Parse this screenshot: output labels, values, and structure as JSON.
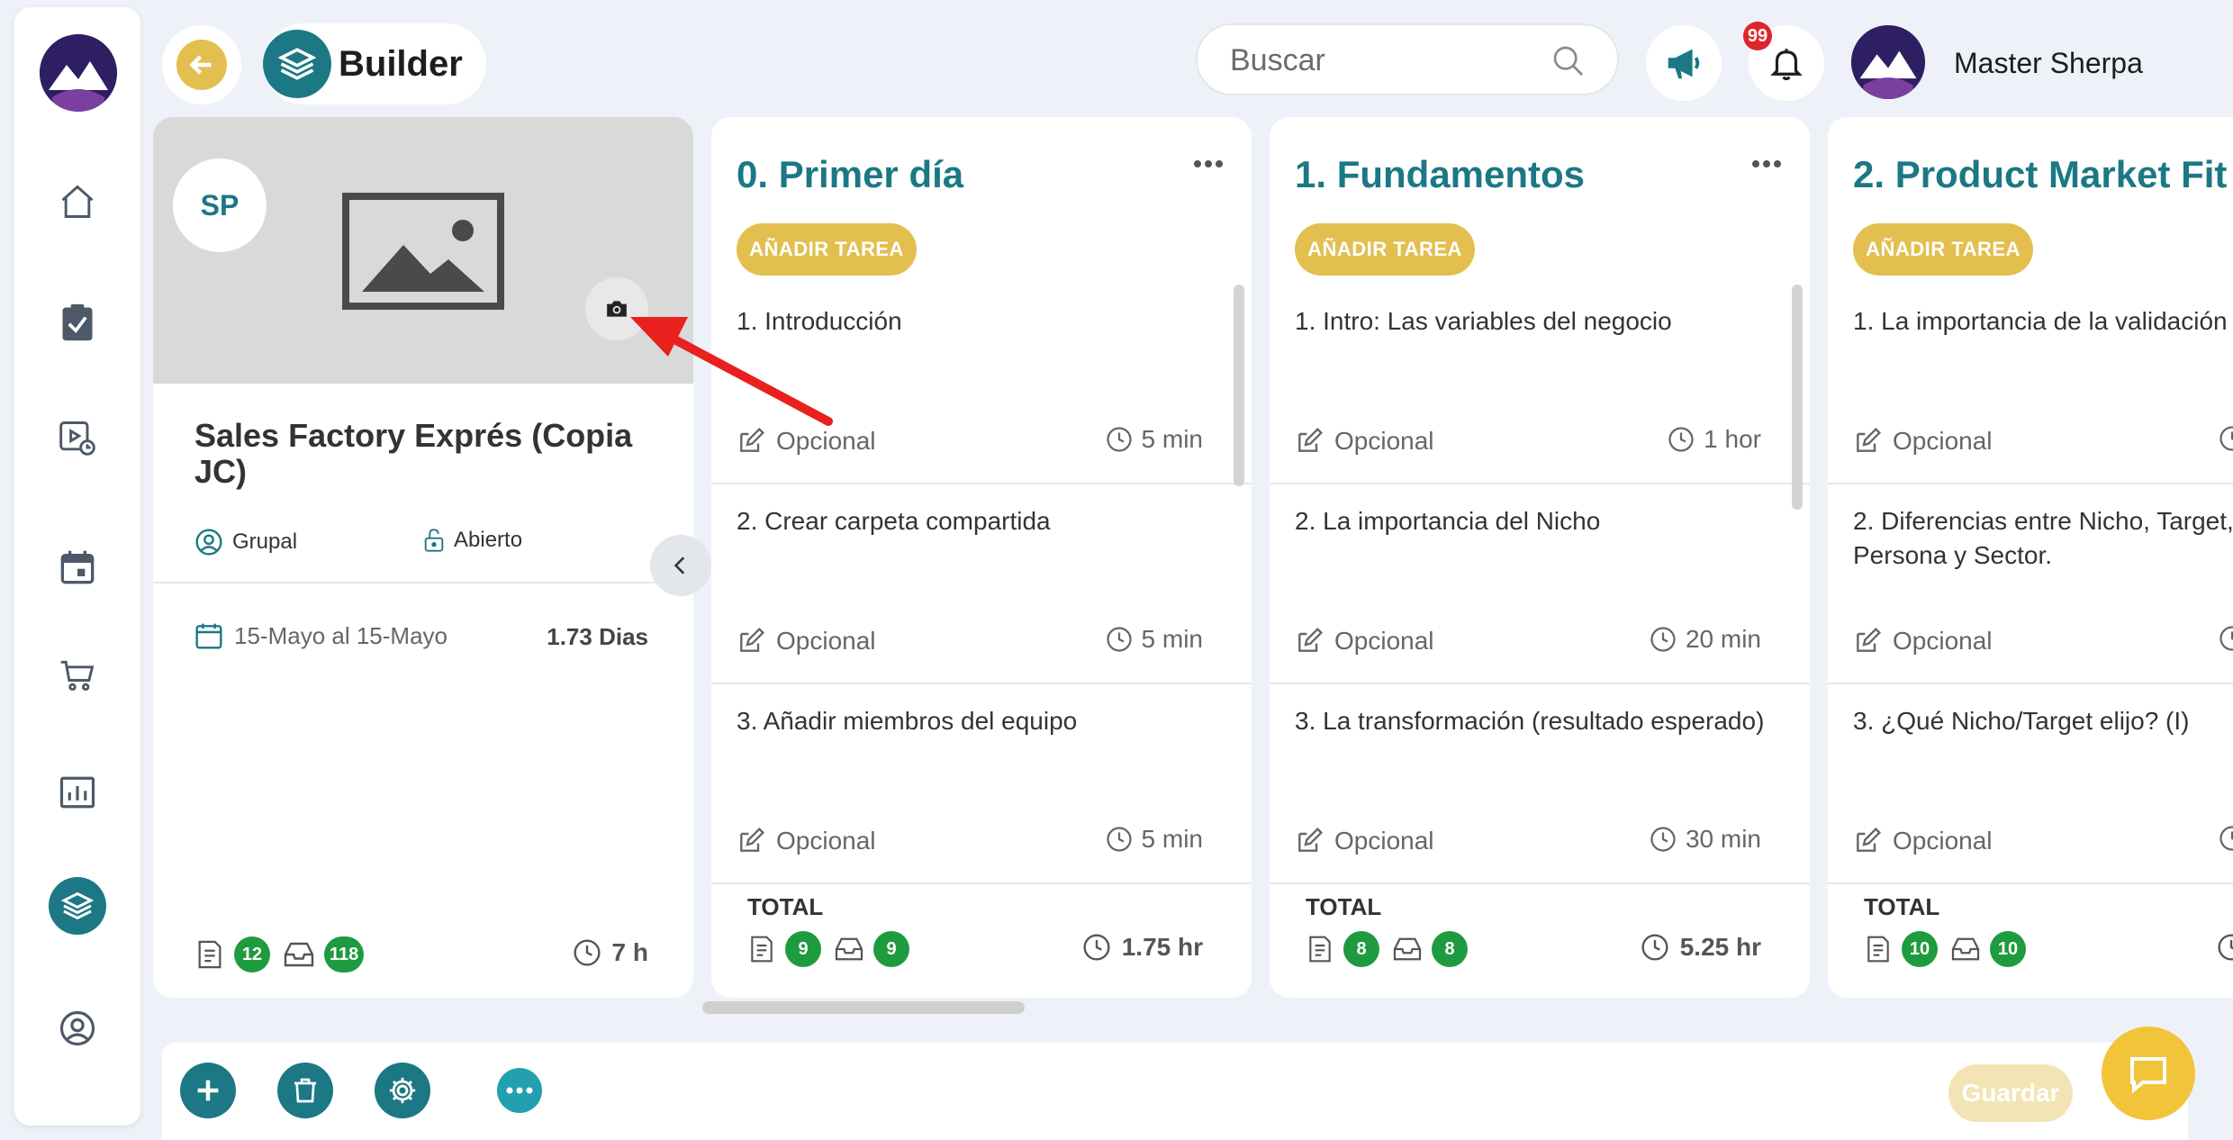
{
  "header": {
    "title": "Builder",
    "search_placeholder": "Buscar",
    "notification_count": "99",
    "user_name": "Master Sherpa"
  },
  "sidebar": {
    "items": [
      {
        "name": "home-icon"
      },
      {
        "name": "tasks-icon"
      },
      {
        "name": "video-icon"
      },
      {
        "name": "calendar-icon"
      },
      {
        "name": "cart-icon"
      },
      {
        "name": "chart-icon"
      },
      {
        "name": "layers-icon",
        "active": true
      },
      {
        "name": "user-icon"
      }
    ]
  },
  "project": {
    "initials": "SP",
    "title": "Sales Factory Exprés (Copia JC)",
    "type_label": "Grupal",
    "access_label": "Abierto",
    "date_range": "15-Mayo al 15-Mayo",
    "duration": "1.73 Dias",
    "count_tasks": "12",
    "count_items": "118",
    "total_hours": "7 h"
  },
  "columns": [
    {
      "title": "0. Primer día",
      "add_label": "AÑADIR TAREA",
      "tasks": [
        {
          "title": "1. Introducción",
          "optional": "Opcional",
          "time": "5 min"
        },
        {
          "title": "2. Crear carpeta compartida",
          "optional": "Opcional",
          "time": "5 min"
        },
        {
          "title": "3. Añadir miembros del equipo",
          "optional": "Opcional",
          "time": "5 min"
        }
      ],
      "total_label": "TOTAL",
      "count_a": "9",
      "count_b": "9",
      "hours": "1.75 hr"
    },
    {
      "title": "1. Fundamentos",
      "add_label": "AÑADIR TAREA",
      "tasks": [
        {
          "title": "1. Intro: Las variables del negocio",
          "optional": "Opcional",
          "time": "1 hor"
        },
        {
          "title": "2. La importancia del Nicho",
          "optional": "Opcional",
          "time": "20 min"
        },
        {
          "title": "3. La transformación (resultado esperado)",
          "optional": "Opcional",
          "time": "30 min"
        }
      ],
      "total_label": "TOTAL",
      "count_a": "8",
      "count_b": "8",
      "hours": "5.25 hr"
    },
    {
      "title": "2. Product Market Fit",
      "add_label": "AÑADIR TAREA",
      "tasks": [
        {
          "title": "1. La importancia de la validación",
          "optional": "Opcional",
          "time": ""
        },
        {
          "title": "2. Diferencias entre Nicho, Target, Persona y Sector.",
          "optional": "Opcional",
          "time": ""
        },
        {
          "title": "3. ¿Qué Nicho/Target elijo? (I)",
          "optional": "Opcional",
          "time": ""
        }
      ],
      "total_label": "TOTAL",
      "count_a": "10",
      "count_b": "10",
      "hours": ""
    }
  ],
  "actions": {
    "save_label": "Guardar"
  },
  "colors": {
    "teal": "#1b7884",
    "gold": "#e3bf4f",
    "green_badge": "#1e9b3e",
    "annotation_arrow": "#e8201e"
  }
}
